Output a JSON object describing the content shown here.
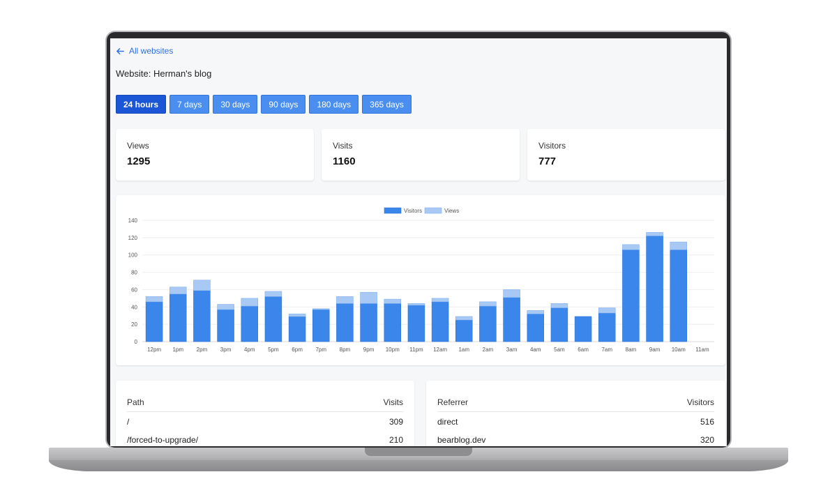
{
  "nav": {
    "back_label": "All websites"
  },
  "site": {
    "title": "Website: Herman's blog"
  },
  "ranges": [
    {
      "label": "24 hours",
      "active": true
    },
    {
      "label": "7 days"
    },
    {
      "label": "30 days"
    },
    {
      "label": "90 days"
    },
    {
      "label": "180 days"
    },
    {
      "label": "365 days"
    }
  ],
  "stats": [
    {
      "label": "Views",
      "value": "1295"
    },
    {
      "label": "Visits",
      "value": "1160"
    },
    {
      "label": "Visitors",
      "value": "777"
    }
  ],
  "colors": {
    "accent": "#1a56d6",
    "visitors": "#3a86eb",
    "views": "#a9c9f5",
    "button": "#4a8ef0"
  },
  "chart_data": {
    "type": "bar",
    "stacked": true,
    "legend_position": "top",
    "categories": [
      "12pm",
      "1pm",
      "2pm",
      "3pm",
      "4pm",
      "5pm",
      "6pm",
      "7pm",
      "8pm",
      "9pm",
      "10pm",
      "11pm",
      "12am",
      "1am",
      "2am",
      "3am",
      "4am",
      "5am",
      "6am",
      "7am",
      "8am",
      "9am",
      "10am",
      "11am"
    ],
    "series": [
      {
        "name": "Visitors",
        "values": [
          46,
          55,
          59,
          37,
          41,
          52,
          29,
          37,
          44,
          44,
          44,
          42,
          46,
          25,
          41,
          51,
          32,
          39,
          29,
          33,
          106,
          122,
          106,
          0
        ]
      },
      {
        "name": "Views",
        "values": [
          6,
          8,
          12,
          6,
          9,
          6,
          3,
          1,
          8,
          13,
          5,
          2,
          4,
          4,
          5,
          9,
          4,
          5,
          0,
          6,
          6,
          4,
          9,
          0
        ]
      }
    ],
    "ylim": [
      0,
      140
    ],
    "yticks": [
      0,
      20,
      40,
      60,
      80,
      100,
      120,
      140
    ],
    "grid": true
  },
  "paths_table": {
    "headers": [
      "Path",
      "Visits"
    ],
    "rows": [
      [
        "/",
        "309"
      ],
      [
        "/forced-to-upgrade/",
        "210"
      ]
    ]
  },
  "referrers_table": {
    "headers": [
      "Referrer",
      "Visitors"
    ],
    "rows": [
      [
        "direct",
        "516"
      ],
      [
        "bearblog.dev",
        "320"
      ]
    ]
  }
}
